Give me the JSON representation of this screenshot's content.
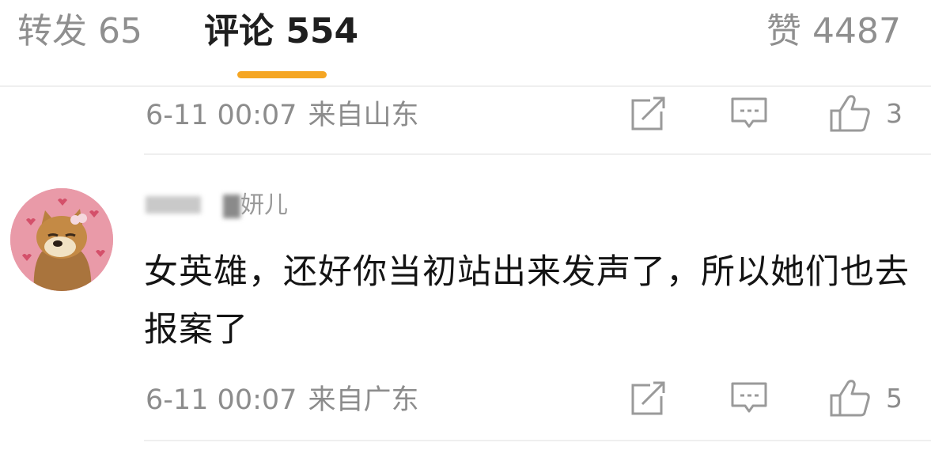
{
  "tabs": {
    "repost": "转发 65",
    "comment": "评论 554",
    "like": "赞 4487"
  },
  "comments": [
    {
      "time": "6-11 00:07",
      "location": "来自山东",
      "like_count": "3"
    },
    {
      "username_visible": "妍儿",
      "text": "女英雄，还好你当初站出来发声了，所以她们也去报案了",
      "time": "6-11 00:07",
      "location": "来自广东",
      "like_count": "5"
    }
  ],
  "colors": {
    "accent_underline": "#f5a623",
    "muted_text": "#8c8c8c",
    "main_text": "#141414",
    "avatar_bg": "#e99aa8"
  },
  "icons": {
    "share": "share-icon",
    "reply": "comment-icon",
    "like": "thumbs-up-icon"
  }
}
